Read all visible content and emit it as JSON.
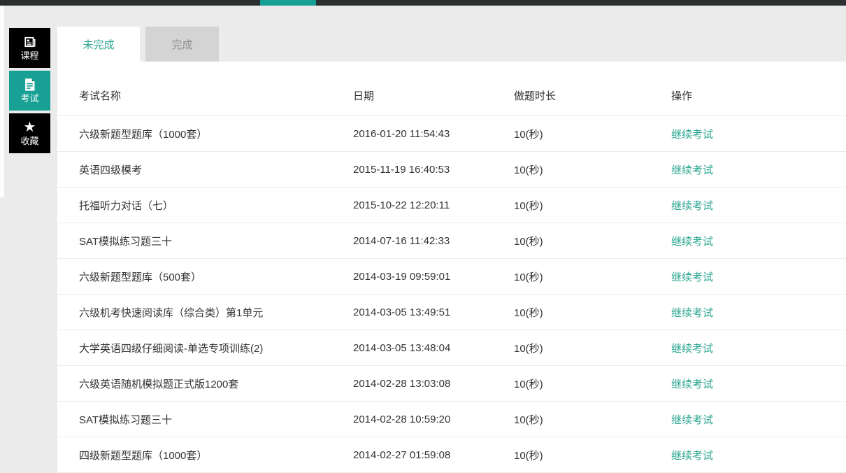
{
  "theme": {
    "accent": "#17a093",
    "accent_text": "#2aa58f",
    "topbar_bg": "#2c2f2f",
    "page_bg": "#ebebeb",
    "tab_inactive_bg": "#d4d4d4",
    "sidebar_bg": "#000000"
  },
  "sidebar": {
    "items": [
      {
        "label": "课程",
        "icon": "book-icon",
        "active": false
      },
      {
        "label": "考试",
        "icon": "file-text-icon",
        "active": true
      },
      {
        "label": "收藏",
        "icon": "star-icon",
        "active": false
      }
    ]
  },
  "tabs": [
    {
      "label": "未完成",
      "active": true
    },
    {
      "label": "完成",
      "active": false
    }
  ],
  "table": {
    "columns": [
      "考试名称",
      "日期",
      "做题时长",
      "操作"
    ],
    "rows": [
      {
        "name": "六级新题型题库（1000套）",
        "date": "2016-01-20 11:54:43",
        "duration": "10(秒)",
        "action": "继续考试"
      },
      {
        "name": "英语四级模考",
        "date": "2015-11-19 16:40:53",
        "duration": "10(秒)",
        "action": "继续考试"
      },
      {
        "name": "托福听力对话（七）",
        "date": "2015-10-22 12:20:11",
        "duration": "10(秒)",
        "action": "继续考试"
      },
      {
        "name": "SAT模拟练习题三十",
        "date": "2014-07-16 11:42:33",
        "duration": "10(秒)",
        "action": "继续考试"
      },
      {
        "name": "六级新题型题库（500套）",
        "date": "2014-03-19 09:59:01",
        "duration": "10(秒)",
        "action": "继续考试"
      },
      {
        "name": "六级机考快速阅读库（综合类）第1单元",
        "date": "2014-03-05 13:49:51",
        "duration": "10(秒)",
        "action": "继续考试"
      },
      {
        "name": "大学英语四级仔细阅读-单选专项训练(2)",
        "date": "2014-03-05 13:48:04",
        "duration": "10(秒)",
        "action": "继续考试"
      },
      {
        "name": "六级英语随机模拟题正式版1200套",
        "date": "2014-02-28 13:03:08",
        "duration": "10(秒)",
        "action": "继续考试"
      },
      {
        "name": "SAT模拟练习题三十",
        "date": "2014-02-28 10:59:20",
        "duration": "10(秒)",
        "action": "继续考试"
      },
      {
        "name": "四级新题型题库（1000套）",
        "date": "2014-02-27 01:59:08",
        "duration": "10(秒)",
        "action": "继续考试"
      }
    ]
  }
}
